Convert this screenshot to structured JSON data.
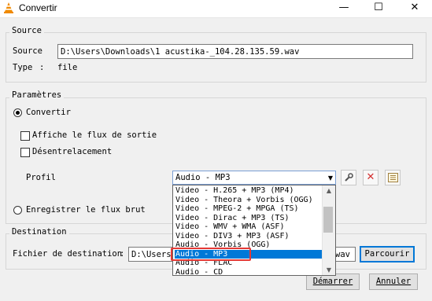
{
  "window": {
    "title": "Convertir",
    "minimize_glyph": "—",
    "maximize_glyph": "☐",
    "close_glyph": "✕",
    "icon": "vlc-cone-icon",
    "accent": "#0078d7"
  },
  "source": {
    "legend": "Source",
    "source_label": "Source",
    "source_value": "D:\\Users\\Downloads\\1 acustika-_104.28.135.59.wav",
    "type_label": "Type",
    "type_sep": ":",
    "type_value": "file"
  },
  "params": {
    "legend": "Paramètres",
    "convert_label": "Convertir",
    "show_output_label": "Affiche le flux de sortie",
    "deinterlace_label": "Désentrelacement",
    "profile_label": "Profil",
    "profile_value": "Audio - MP3",
    "raw_dump_label": "Enregistrer le flux brut",
    "tool_icons": [
      "wrench-icon",
      "delete-icon",
      "new-profile-icon"
    ]
  },
  "dropdown": {
    "items": [
      "Video - H.265 + MP3 (MP4)",
      "Video - Theora + Vorbis (OGG)",
      "Video - MPEG-2 + MPGA (TS)",
      "Video - Dirac + MP3 (TS)",
      "Video - WMV + WMA (ASF)",
      "Video - DIV3 + MP3 (ASF)",
      "Audio - Vorbis (OGG)",
      "Audio - MP3",
      "Audio - FLAC",
      "Audio - CD"
    ],
    "selected_index": 7
  },
  "destination": {
    "legend": "Destination",
    "file_label": "Fichier de destination",
    "sep": ":",
    "file_value_start": "D:\\Users",
    "file_value_end": "wav",
    "browse_label": "Parcourir"
  },
  "footer": {
    "start_label": "Démarrer",
    "cancel_label": "Annuler"
  }
}
